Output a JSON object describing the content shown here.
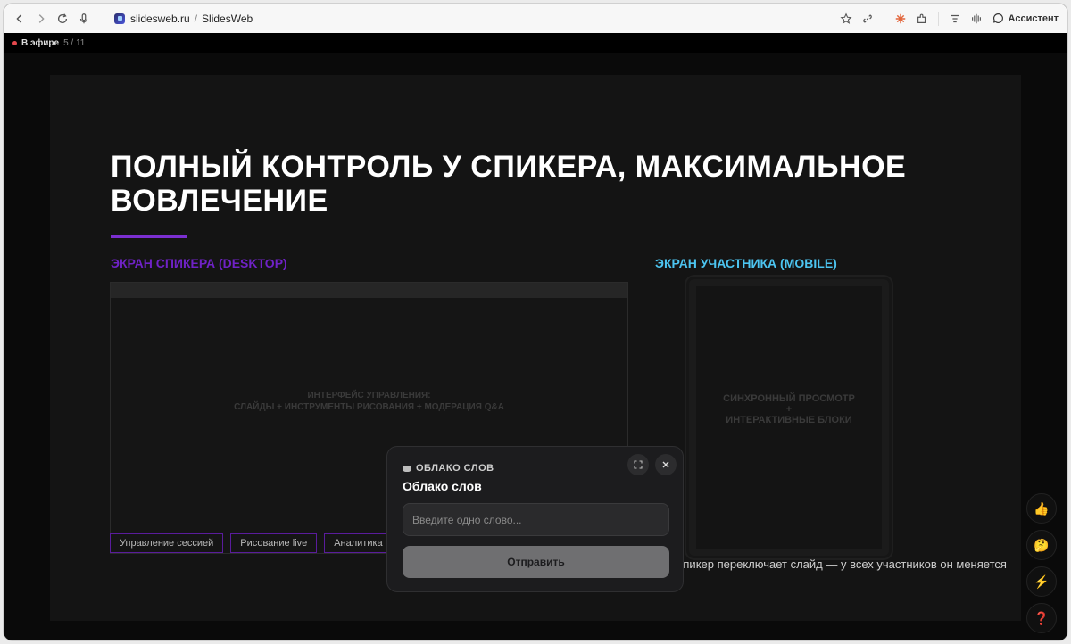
{
  "browser": {
    "domain": "slidesweb.ru",
    "page_title": "SlidesWeb",
    "assistant_label": "Ассистент"
  },
  "presenter": {
    "live_label": "В эфире",
    "slide_counter": "5 / 11"
  },
  "slide": {
    "title": "ПОЛНЫЙ КОНТРОЛЬ У СПИКЕРА, МАКСИМАЛЬНОЕ ВОВЛЕЧЕНИЕ",
    "left_heading": "ЭКРАН СПИКЕРА (DESKTOP)",
    "right_heading": "ЭКРАН УЧАСТНИКА (MOBILE)",
    "desktop_text_line1": "ИНТЕРФЕЙС УПРАВЛЕНИЯ:",
    "desktop_text_line2": "СЛАЙДЫ + ИНСТРУМЕНТЫ РИСОВАНИЯ + МОДЕРАЦИЯ Q&A",
    "chips": [
      "Управление сессией",
      "Рисование live",
      "Аналитика"
    ],
    "mobile_text_line1": "СИНХРОННЫЙ ПРОСМОТР",
    "mobile_text_line2": "+",
    "mobile_text_line3": "ИНТЕРАКТИВНЫЕ БЛОКИ",
    "caption": "Спикер переключает слайд — у всех участников он меняется"
  },
  "word_cloud_modal": {
    "eyebrow": "ОБЛАКО СЛОВ",
    "title": "Облако слов",
    "input_placeholder": "Введите одно слово...",
    "input_value": "",
    "submit_label": "Отправить"
  },
  "reactions": [
    "👍",
    "🤔",
    "⚡",
    "❓"
  ],
  "colors": {
    "accent_purple": "#6f22c6",
    "accent_blue": "#4cc4f0",
    "live_red": "#e5484d"
  }
}
